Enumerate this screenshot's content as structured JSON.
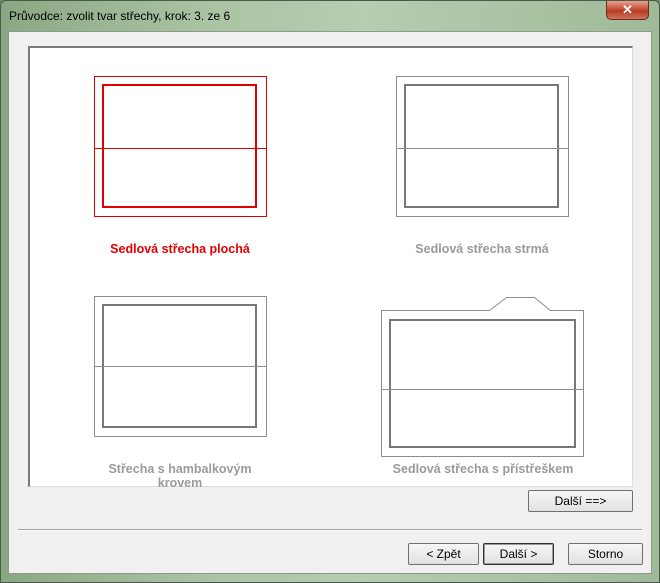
{
  "window": {
    "title": "Průvodce: zvolit tvar střechy, krok: 3. ze 6",
    "close_glyph": "✕"
  },
  "options": [
    {
      "label": "Sedlová střecha plochá",
      "selected": true
    },
    {
      "label": "Sedlová střecha strmá",
      "selected": false
    },
    {
      "label": "Střecha s hambalkovým krovem",
      "selected": false
    },
    {
      "label": "Sedlová střecha s přístřeškem",
      "selected": false
    }
  ],
  "buttons": {
    "next_inner": "Další ==>",
    "back": "< Zpět",
    "next": "Další >",
    "cancel": "Storno"
  },
  "colors": {
    "selected": "#e00000",
    "unselected": "#9a9a9a"
  }
}
